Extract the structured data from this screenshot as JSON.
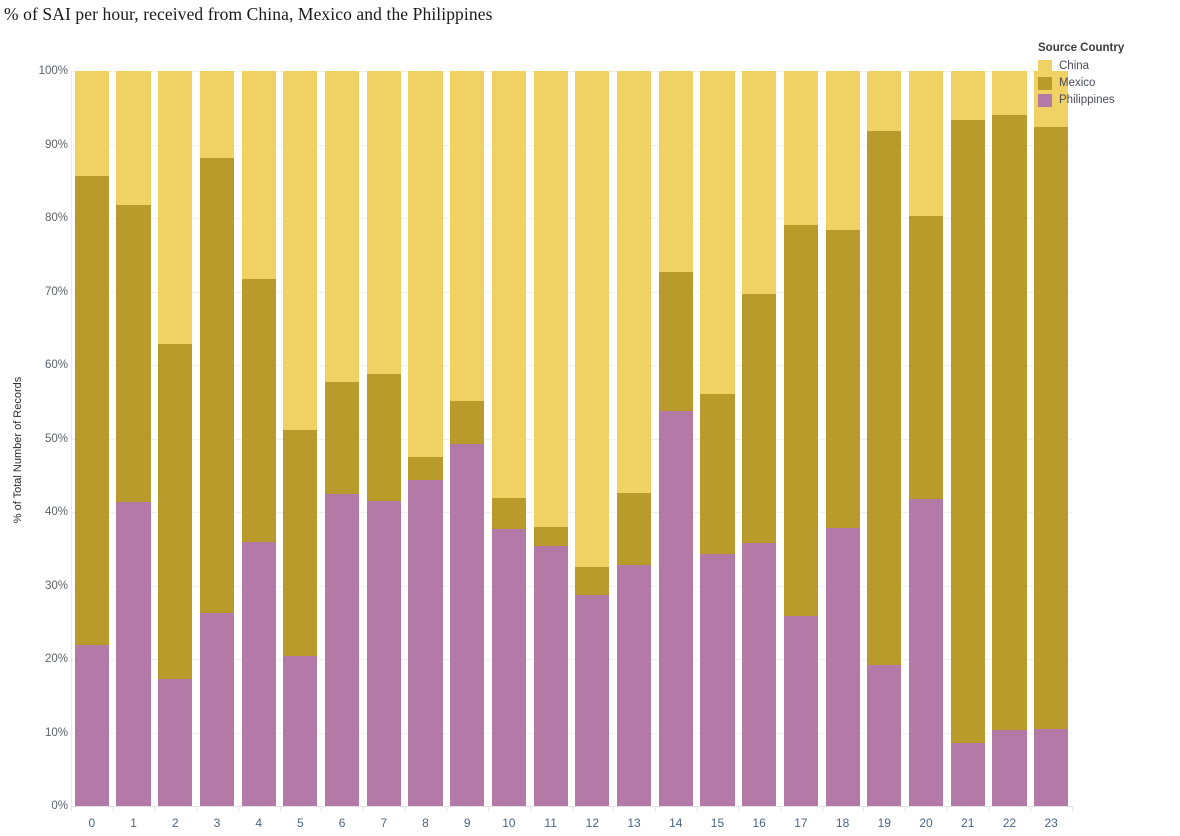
{
  "chart": {
    "title": "% of SAI per hour, received from China, Mexico and the Philippines",
    "ylabel": "% of Total Number of Records"
  },
  "legend": {
    "title": "Source Country",
    "items": [
      {
        "label": "China",
        "color": "#f0d163"
      },
      {
        "label": "Mexico",
        "color": "#b89b2a"
      },
      {
        "label": "Philippines",
        "color": "#b37aa8"
      }
    ]
  },
  "yaxis": {
    "ticks": [
      "0%",
      "10%",
      "20%",
      "30%",
      "40%",
      "50%",
      "60%",
      "70%",
      "80%",
      "90%",
      "100%"
    ]
  },
  "chart_data": {
    "type": "bar",
    "subtype": "stacked-100-percent",
    "title": "% of SAI per hour, received from China, Mexico and the Philippines",
    "xlabel": "",
    "ylabel": "% of Total Number of Records",
    "ylim": [
      0,
      100
    ],
    "ytick_values": [
      0,
      10,
      20,
      30,
      40,
      50,
      60,
      70,
      80,
      90,
      100
    ],
    "grid": true,
    "legend_position": "right",
    "legend_title": "Source Country",
    "categories": [
      "0",
      "1",
      "2",
      "3",
      "4",
      "5",
      "6",
      "7",
      "8",
      "9",
      "10",
      "11",
      "12",
      "13",
      "14",
      "15",
      "16",
      "17",
      "18",
      "19",
      "20",
      "21",
      "22",
      "23"
    ],
    "series": [
      {
        "name": "Philippines",
        "color": "#b37aa8",
        "values": [
          21.9,
          41.4,
          17.3,
          26.3,
          35.9,
          20.4,
          42.5,
          41.5,
          44.3,
          49.2,
          37.7,
          35.4,
          28.7,
          32.8,
          53.8,
          34.3,
          35.8,
          25.8,
          37.8,
          19.2,
          41.8,
          8.6,
          10.4,
          10.5
        ]
      },
      {
        "name": "Mexico",
        "color": "#b89b2a",
        "values": [
          63.8,
          40.4,
          45.5,
          61.8,
          35.8,
          30.8,
          15.2,
          17.3,
          3.2,
          5.9,
          4.2,
          2.6,
          3.8,
          9.8,
          18.8,
          21.8,
          33.9,
          53.2,
          40.6,
          72.7,
          38.5,
          84.7,
          83.6,
          81.9
        ]
      },
      {
        "name": "China",
        "color": "#f0d163",
        "values": [
          14.3,
          18.2,
          37.2,
          11.9,
          28.3,
          48.8,
          42.3,
          41.2,
          52.5,
          44.9,
          58.1,
          62.0,
          67.5,
          57.4,
          27.4,
          43.9,
          30.3,
          21.0,
          21.6,
          8.1,
          19.7,
          6.7,
          6.0,
          7.6
        ]
      }
    ]
  }
}
